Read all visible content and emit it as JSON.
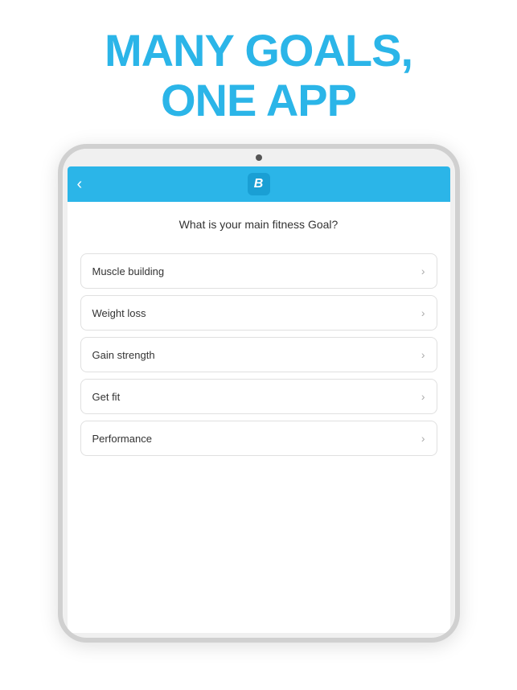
{
  "headline": {
    "line1": "MANY GOALS,",
    "line2": "ONE APP"
  },
  "navbar": {
    "back_icon": "‹",
    "logo_text": "B"
  },
  "app": {
    "question": "What is your main fitness Goal?",
    "options": [
      {
        "label": "Muscle building"
      },
      {
        "label": "Weight loss"
      },
      {
        "label": "Gain strength"
      },
      {
        "label": "Get fit"
      },
      {
        "label": "Performance"
      }
    ]
  },
  "colors": {
    "accent": "#2bb5e8",
    "text_dark": "#333333",
    "text_light": "#aaaaaa",
    "border": "#e0e0e0"
  }
}
